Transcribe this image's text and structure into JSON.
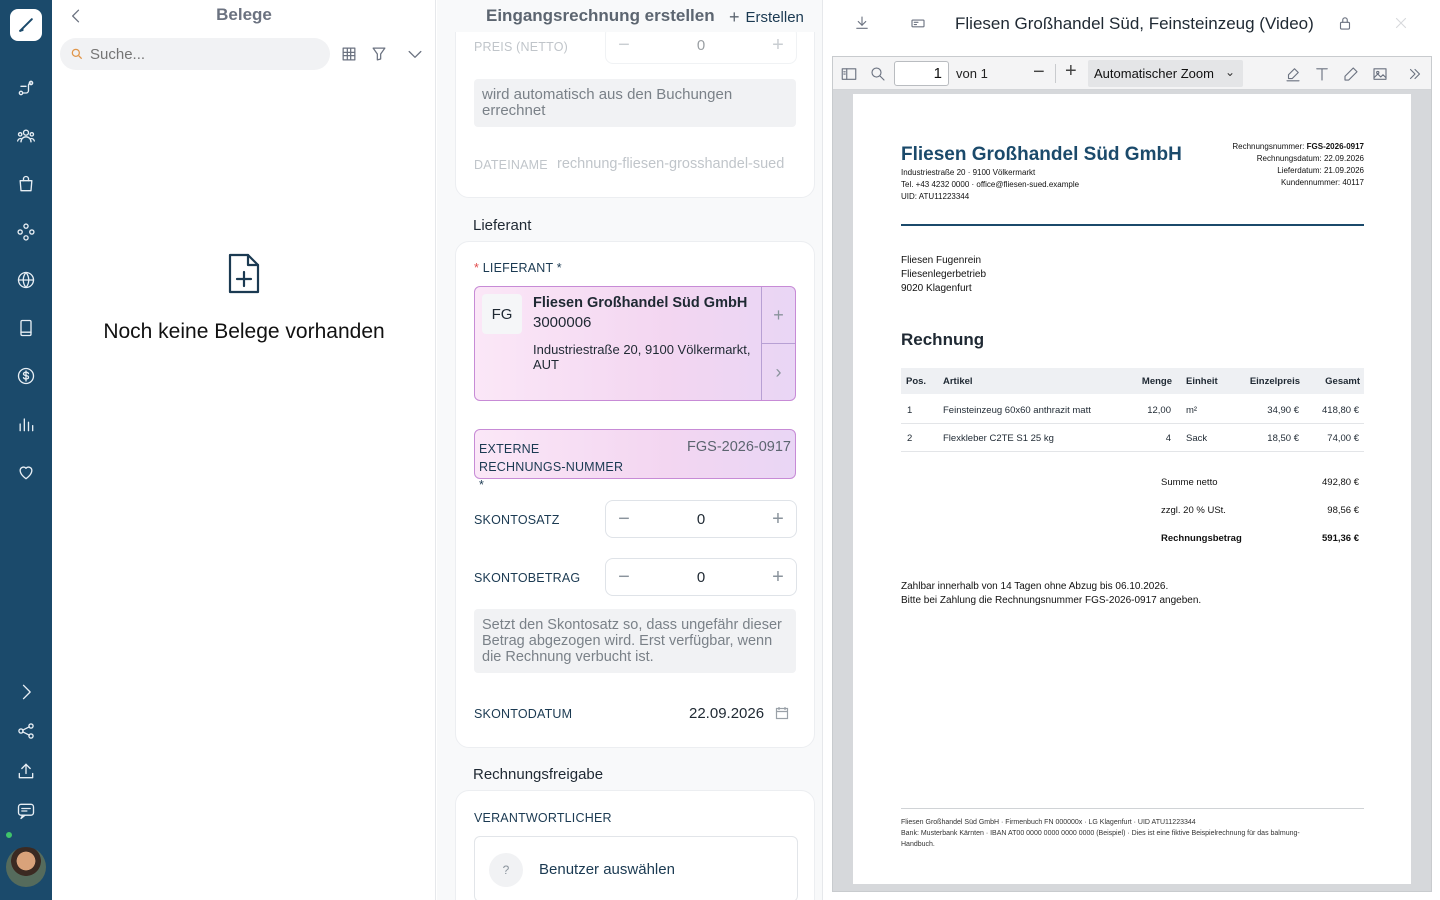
{
  "belege": {
    "title": "Belege",
    "search_placeholder": "Suche...",
    "empty_text": "Noch keine Belege vorhanden"
  },
  "form": {
    "header_title": "Eingangsrechnung erstellen",
    "create_label": "Erstellen",
    "preis_label": "PREIS (NETTO)",
    "preis_value": "0",
    "auto_note": "wird automatisch aus den Buchungen errechnet",
    "dateiname_label": "DATEINAME",
    "dateiname_value": "rechnung-fliesen-grosshandel-sued",
    "lieferant_section": "Lieferant",
    "lieferant_label": "LIEFERANT *",
    "supplier": {
      "initials": "FG",
      "name": "Fliesen Großhandel Süd GmbH",
      "number": "3000006",
      "address": "Industriestraße 20, 9100 Völkermarkt, AUT"
    },
    "ext_number_label": "EXTERNE RECHNUNGS-NUMMER *",
    "ext_number_value": "FGS-2026-0917",
    "skontosatz_label": "SKONTOSATZ",
    "skontosatz_value": "0",
    "skontobetrag_label": "SKONTOBETRAG",
    "skontobetrag_value": "0",
    "skonto_note": "Setzt den Skontosatz so, dass ungefähr dieser Betrag abgezogen wird. Erst verfügbar, wenn die Rechnung verbucht ist.",
    "skontodatum_label": "SKONTODATUM",
    "skontodatum_value": "22.09.2026",
    "freigabe_section": "Rechnungsfreigabe",
    "verantwortlicher_label": "VERANTWORTLICHER",
    "user_pick_label": "Benutzer auswählen"
  },
  "viewer": {
    "title": "Fliesen Großhandel Süd, Feinsteinzeug (Video)",
    "page_value": "1",
    "page_of": "von 1",
    "zoom": "Automatischer Zoom"
  },
  "invoice": {
    "company": "Fliesen Großhandel Süd GmbH",
    "company_lines": [
      "Industriestraße 20 · 9100 Völkermarkt",
      "Tel. +43 4232 0000 · office@fliesen-sued.example",
      "UID: ATU11223344"
    ],
    "meta": [
      {
        "k": "Rechnungsnummer:",
        "v": "FGS-2026-0917"
      },
      {
        "k": "Rechnungsdatum:",
        "v": "22.09.2026"
      },
      {
        "k": "Lieferdatum:",
        "v": "21.09.2026"
      },
      {
        "k": "Kundennummer:",
        "v": "40117"
      }
    ],
    "recipient": [
      "Fliesen Fugenrein",
      "Fliesenlegerbetrieb",
      "9020 Klagenfurt"
    ],
    "heading": "Rechnung",
    "columns": [
      "Pos.",
      "Artikel",
      "Menge",
      "Einheit",
      "Einzelpreis",
      "Gesamt"
    ],
    "rows": [
      [
        "1",
        "Feinsteinzeug 60x60 anthrazit matt",
        "12,00",
        "m²",
        "34,90 €",
        "418,80 €"
      ],
      [
        "2",
        "Flexkleber C2TE S1 25 kg",
        "4",
        "Sack",
        "18,50 €",
        "74,00 €"
      ]
    ],
    "totals": [
      {
        "k": "Summe netto",
        "v": "492,80 €"
      },
      {
        "k": "zzgl. 20 % USt.",
        "v": "98,56 €"
      },
      {
        "k": "Rechnungsbetrag",
        "v": "591,36 €"
      }
    ],
    "payment_lines": [
      "Zahlbar innerhalb von 14 Tagen ohne Abzug bis 06.10.2026.",
      "Bitte bei Zahlung die Rechnungsnummer FGS-2026-0917 angeben."
    ],
    "footer_lines": [
      "Fliesen Großhandel Süd GmbH · Firmenbuch FN 000000x · LG Klagenfurt · UID ATU11223344",
      "Bank: Musterbank Kärnten · IBAN AT00 0000 0000 0000 0000 (Beispiel) · Dies ist eine fiktive Beispielrechnung für das balmung-",
      "Handbuch."
    ]
  },
  "colors": {
    "rail": "#1b4a6b",
    "brand": "#1b4a6b",
    "highlight_border": "#c78bd6",
    "online": "#3fc46a"
  }
}
